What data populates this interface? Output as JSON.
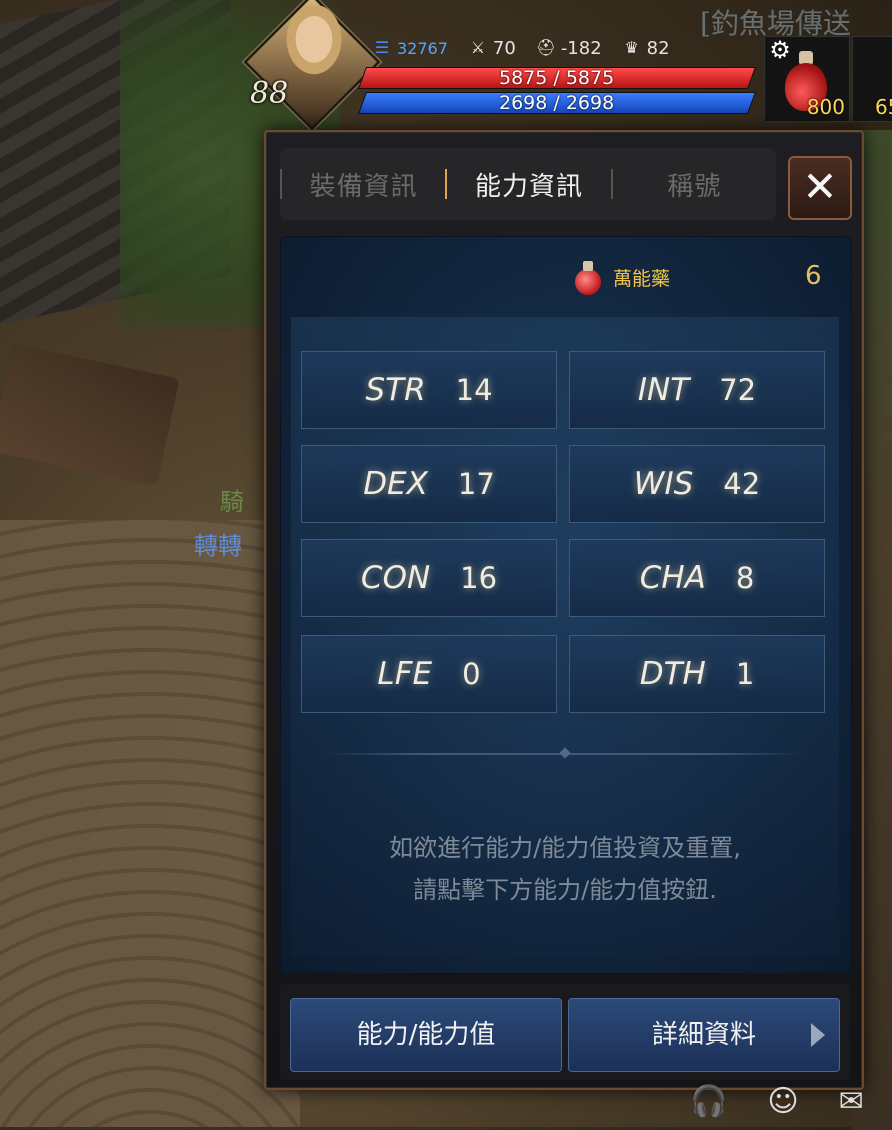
{
  "hud": {
    "level": "88",
    "gold": "32767",
    "stat_a": "70",
    "stat_b": "-182",
    "stat_c": "82",
    "hp": "5875 / 5875",
    "mp": "2698 / 2698",
    "potion_count_1": "800",
    "potion_count_2": "65"
  },
  "background": {
    "top_text": "[釣魚場傳送",
    "side_text": "騎",
    "side_text_2": "轉轉"
  },
  "tabs": [
    {
      "label": "裝備資訊",
      "active": false
    },
    {
      "label": "能力資訊",
      "active": true
    },
    {
      "label": "稱號",
      "active": false
    }
  ],
  "elixir": {
    "label": "萬能藥",
    "count": "6"
  },
  "stats": [
    {
      "name": "STR",
      "value": "14"
    },
    {
      "name": "INT",
      "value": "72"
    },
    {
      "name": "DEX",
      "value": "17"
    },
    {
      "name": "WIS",
      "value": "42"
    },
    {
      "name": "CON",
      "value": "16"
    },
    {
      "name": "CHA",
      "value": "8"
    },
    {
      "name": "LFE",
      "value": "0"
    },
    {
      "name": "DTH",
      "value": "1"
    }
  ],
  "hint": {
    "line1": "如欲進行能力/能力值投資及重置,",
    "line2": "請點擊下方能力/能力值按鈕."
  },
  "buttons": {
    "ability": "能力/能力值",
    "details": "詳細資料"
  },
  "icons": {
    "close": "close-icon",
    "gear": "gear-icon"
  }
}
